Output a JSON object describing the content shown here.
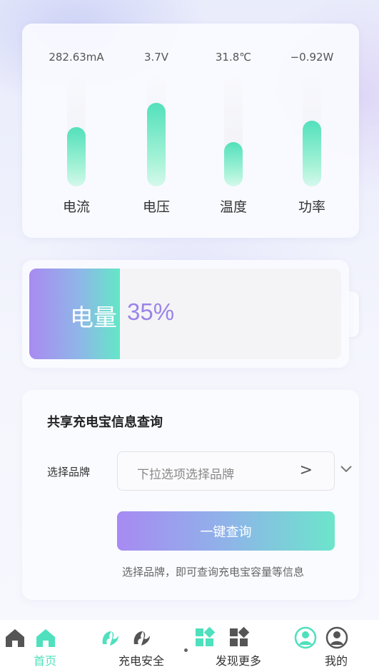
{
  "metrics": [
    {
      "value": "282.63mA",
      "label": "电流",
      "level": 0.54
    },
    {
      "value": "3.7V",
      "label": "电压",
      "level": 0.76
    },
    {
      "value": "31.8℃",
      "label": "温度",
      "level": 0.4
    },
    {
      "value": "−0.92W",
      "label": "功率",
      "level": 0.6
    }
  ],
  "battery": {
    "label": "电量",
    "value": "35%",
    "level": 0.29
  },
  "query": {
    "title": "共享充电宝信息查询",
    "brand_label": "选择品牌",
    "select_placeholder": "下拉选项选择品牌",
    "select_arrow": ">",
    "button_label": "一键查询",
    "hint": "选择品牌，即可查询充电宝容量等信息"
  },
  "tabbar": {
    "tabs": [
      {
        "label": "首页",
        "icon": "home-icon",
        "active": true
      },
      {
        "label": "充电安全",
        "icon": "charge-safety-icon",
        "active": false
      },
      {
        "label": "发现更多",
        "icon": "discover-icon",
        "active": false
      },
      {
        "label": "我的",
        "icon": "profile-icon",
        "active": false
      }
    ]
  },
  "colors": {
    "accent": "#4fe0bd",
    "purple": "#9b84e8"
  }
}
